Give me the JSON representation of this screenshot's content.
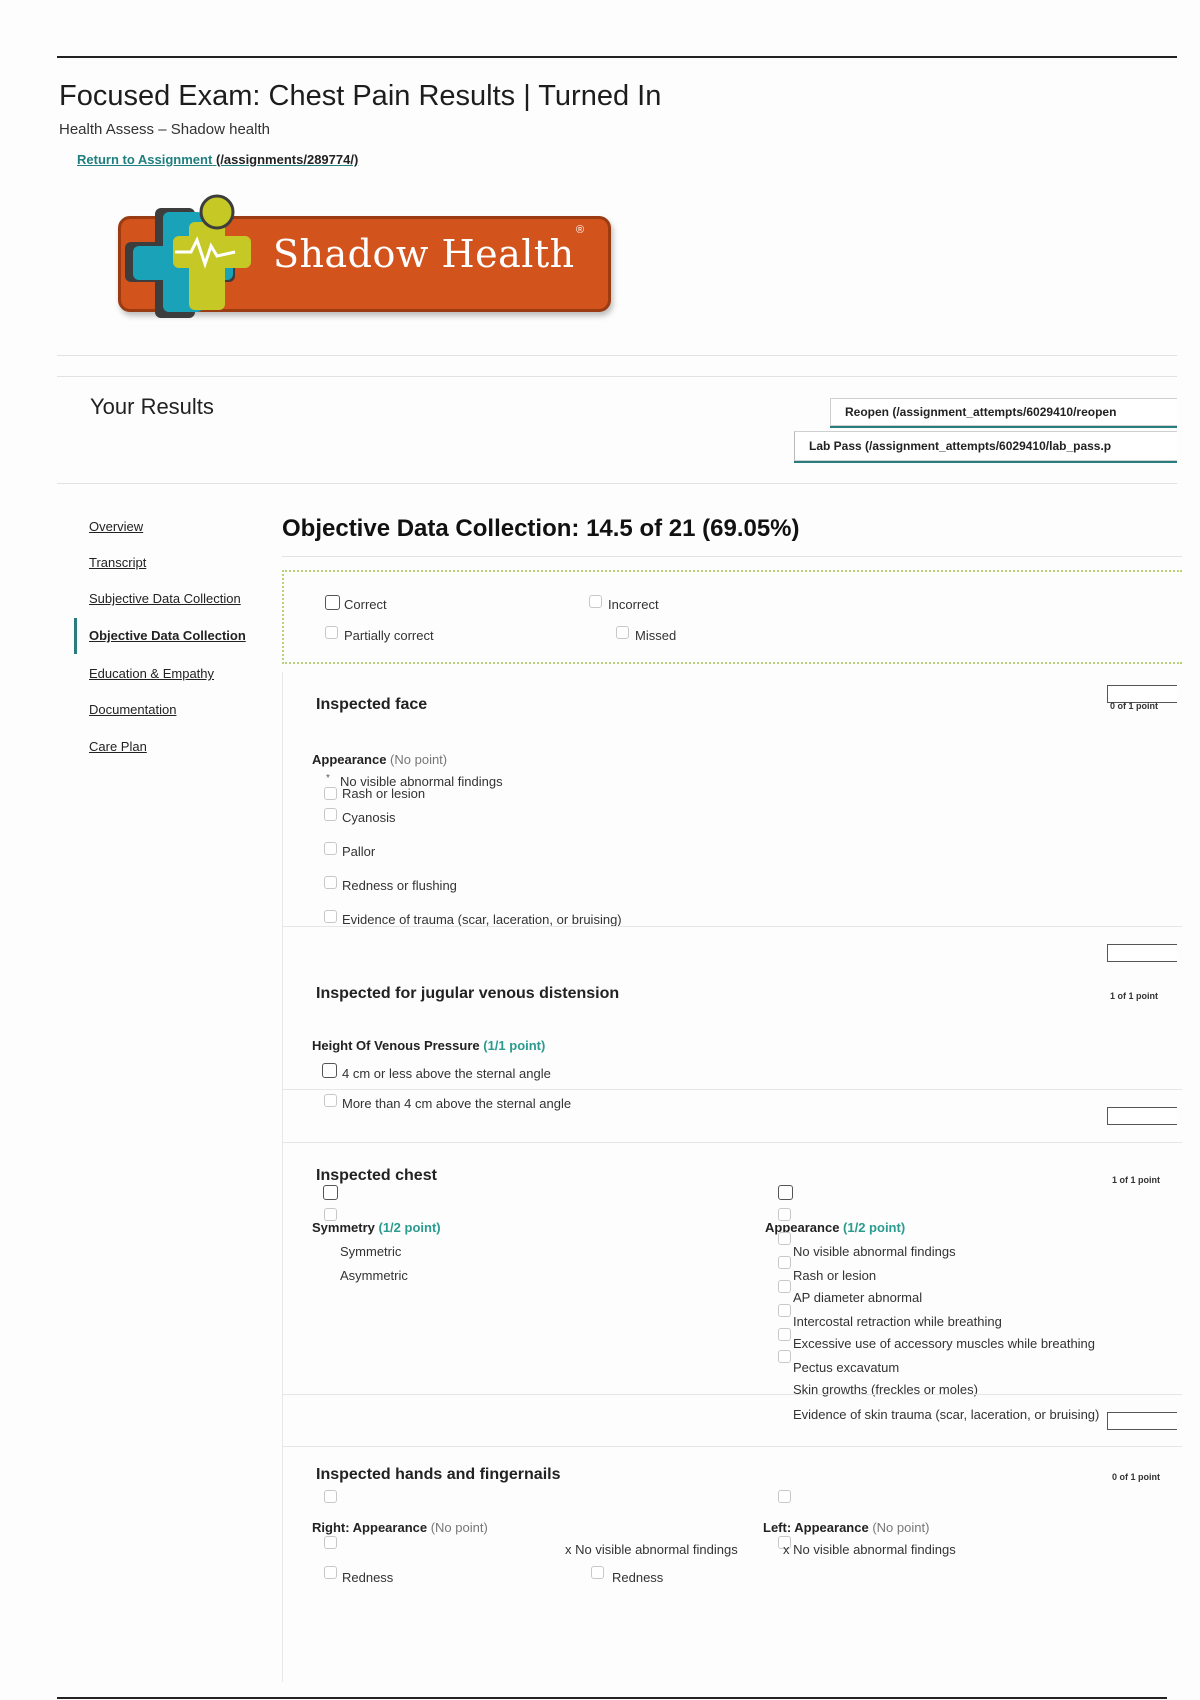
{
  "header": {
    "title": "Focused Exam: Chest Pain Results | Turned In",
    "subtitle": "Health Assess – Shadow health",
    "return_link_label": "Return to Assignment",
    "return_link_path": "(/assignments/289774/)"
  },
  "logo": {
    "text": "Shadow Health",
    "reg": "®"
  },
  "results": {
    "heading": "Your Results",
    "reopen_label": "Reopen (/assignment_attempts/6029410/reopen",
    "labpass_label": "Lab Pass (/assignment_attempts/6029410/lab_pass.p"
  },
  "nav": {
    "items": [
      {
        "label": "Overview"
      },
      {
        "label": "Transcript"
      },
      {
        "label": "Subjective Data Collection"
      },
      {
        "label": "Objective Data Collection"
      },
      {
        "label": "Education & Empathy"
      },
      {
        "label": "Documentation"
      },
      {
        "label": "Care Plan"
      }
    ],
    "active_index": 3
  },
  "section": {
    "title": "Objective Data Collection: 14.5 of 21 (69.05%)"
  },
  "legend": {
    "correct": "Correct",
    "incorrect": "Incorrect",
    "partially_correct": "Partially correct",
    "missed": "Missed"
  },
  "items": {
    "face": {
      "title": "Inspected face",
      "score": "0 of 1 point",
      "question": "Appearance",
      "question_pts": "(No point)",
      "marker": "*",
      "options": [
        "No visible abnormal findings",
        "Rash or lesion",
        "Cyanosis",
        "Pallor",
        "Redness or flushing",
        "Evidence of trauma (scar, laceration, or bruising)"
      ]
    },
    "jvd": {
      "title": "Inspected for jugular venous distension",
      "score": "1 of 1 point",
      "question": "Height Of Venous Pressure",
      "question_pts": "(1/1 point)",
      "options": [
        "4 cm or less above the sternal angle",
        "More than 4 cm above the sternal angle"
      ]
    },
    "chest": {
      "title": "Inspected chest",
      "score": "1 of 1 point",
      "left_question": "Symmetry",
      "left_pts": "(1/2 point)",
      "left_options": [
        "Symmetric",
        "Asymmetric"
      ],
      "right_question": "Appearance",
      "right_pts": "(1/2 point)",
      "right_options": [
        "No visible abnormal findings",
        "Rash or lesion",
        "AP diameter abnormal",
        "Intercostal retraction while breathing",
        "Excessive use of accessory muscles while breathing",
        "Pectus excavatum",
        "Skin growths (freckles or moles)",
        "Evidence of skin trauma (scar, laceration, or bruising)"
      ]
    },
    "hands": {
      "title": "Inspected hands and fingernails",
      "score": "0 of 1 point",
      "right_question": "Right: Appearance",
      "right_pts": "(No point)",
      "left_question": "Left: Appearance",
      "left_pts": "(No point)",
      "x_finding_a": "x No visible abnormal findings",
      "x_finding_b": "x No visible abnormal findings",
      "redness_a": "Redness",
      "redness_b": "Redness"
    }
  },
  "colors": {
    "accent": "#2a7d7d",
    "points": "#2a9b8e",
    "logo": "#d2531c",
    "legend_border": "#b9cf7a"
  }
}
